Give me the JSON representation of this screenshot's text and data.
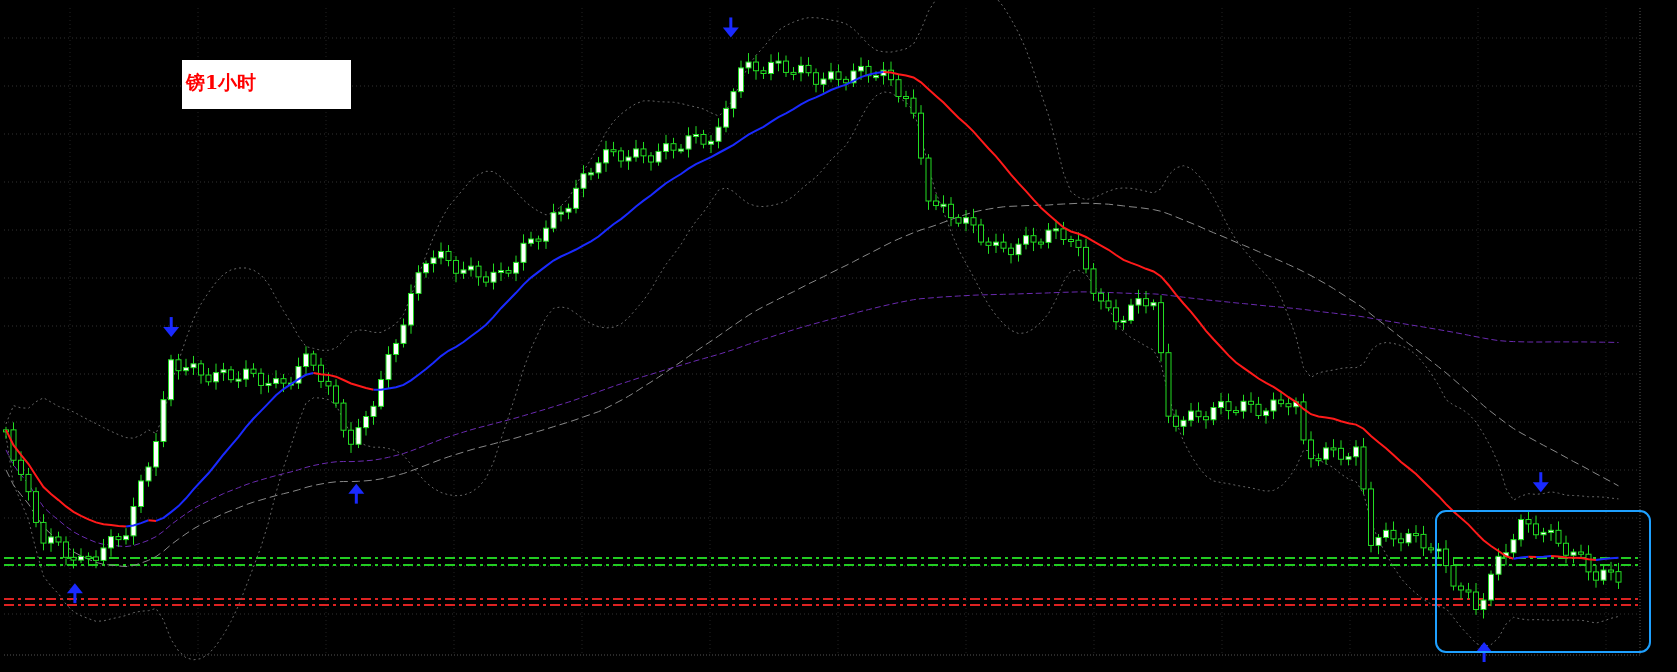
{
  "chart_label": {
    "text": "镑1小时"
  }
}
